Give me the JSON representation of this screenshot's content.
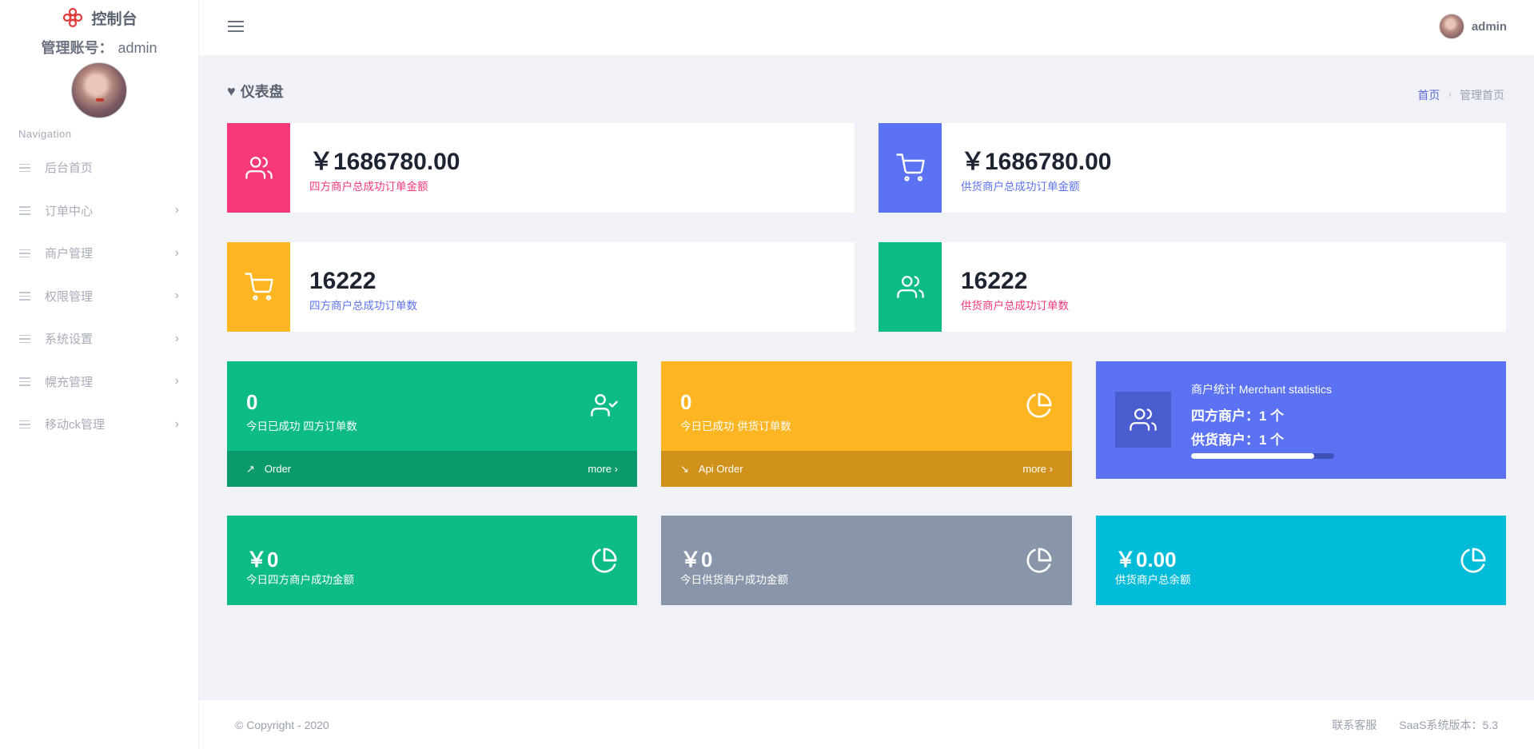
{
  "sidebar": {
    "brand_title": "控制台",
    "account_label": "管理账号：",
    "account_value": "admin",
    "nav_heading": "Navigation",
    "items": [
      {
        "label": "后台首页"
      },
      {
        "label": "订单中心"
      },
      {
        "label": "商户管理"
      },
      {
        "label": "权限管理"
      },
      {
        "label": "系统设置"
      },
      {
        "label": "幌充管理"
      },
      {
        "label": "移动ck管理"
      }
    ]
  },
  "topbar": {
    "user_name": "admin"
  },
  "page": {
    "title": "仪表盘",
    "breadcrumb": {
      "home": "首页",
      "current": "管理首页"
    }
  },
  "stats": [
    {
      "value": "￥1686780.00",
      "label": "四方商户总成功订单金额",
      "color": "#f7397a",
      "icon": "users-icon"
    },
    {
      "value": "￥1686780.00",
      "label": "供货商户总成功订单金额",
      "color": "#5b73f2",
      "icon": "cart-icon"
    },
    {
      "value": "16222",
      "label": "四方商户总成功订单数",
      "color": "#fdb522",
      "icon": "cart-icon"
    },
    {
      "value": "16222",
      "label": "供货商户总成功订单数",
      "color": "#0dbb86",
      "icon": "users-icon"
    }
  ],
  "tiles_row1": [
    {
      "value": "0",
      "label": "今日已成功 四方订单数",
      "footer": "Order",
      "more": "more",
      "color": "#0dbb86",
      "foot_color": "#0a9a6c",
      "icon": "user-check-icon",
      "footer_icon": "trend-up-icon"
    },
    {
      "value": "0",
      "label": "今日已成功 供货订单数",
      "footer": "Api Order",
      "more": "more",
      "color": "#fdb522",
      "foot_color": "#d0921a",
      "icon": "pie-chart-icon",
      "footer_icon": "trend-down-icon"
    }
  ],
  "merchant": {
    "heading": "商户统计 Merchant statistics",
    "line1": "四方商户：1 个",
    "line2": "供货商户：1 个",
    "progress": 0.86,
    "icon": "users-icon"
  },
  "tiles_row2": [
    {
      "value": "￥0",
      "label": "今日四方商户成功金额",
      "color": "#0dbb86",
      "icon": "pie-chart-icon"
    },
    {
      "value": "￥0",
      "label": "今日供货商户成功金额",
      "color": "#8995a8",
      "icon": "pie-chart-icon"
    },
    {
      "value": "￥0.00",
      "label": "供货商户总余额",
      "color": "#00bcd8",
      "icon": "pie-chart-icon"
    }
  ],
  "footer": {
    "copyright": "© Copyright - 2020",
    "contact": "联系客服",
    "version": "SaaS系统版本：5.3"
  }
}
